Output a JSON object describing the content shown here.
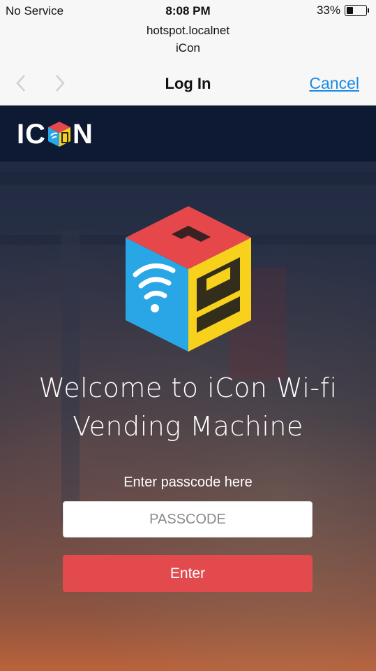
{
  "status_bar": {
    "carrier": "No Service",
    "time": "8:08 PM",
    "battery_percent": "33%",
    "battery_level": 0.33
  },
  "portal_sheet": {
    "host": "hotspot.localnet",
    "network_name": "iCon",
    "title": "Log In",
    "cancel_label": "Cancel",
    "back_icon": "chevron-left-icon",
    "forward_icon": "chevron-right-icon"
  },
  "page": {
    "logo_text_left": "IC",
    "logo_text_right": "N",
    "welcome_line1": "Welcome to iCon Wi-fi",
    "welcome_line2": "Vending Machine",
    "passcode_label": "Enter passcode here",
    "passcode_placeholder": "PASSCODE",
    "passcode_value": "",
    "enter_button_label": "Enter",
    "colors": {
      "header": "#0e1a33",
      "enter_button": "#e24a4e",
      "cube_top": "#e5474b",
      "cube_left": "#29a6e6",
      "cube_right": "#f7d11c",
      "link": "#1a8be6"
    }
  }
}
